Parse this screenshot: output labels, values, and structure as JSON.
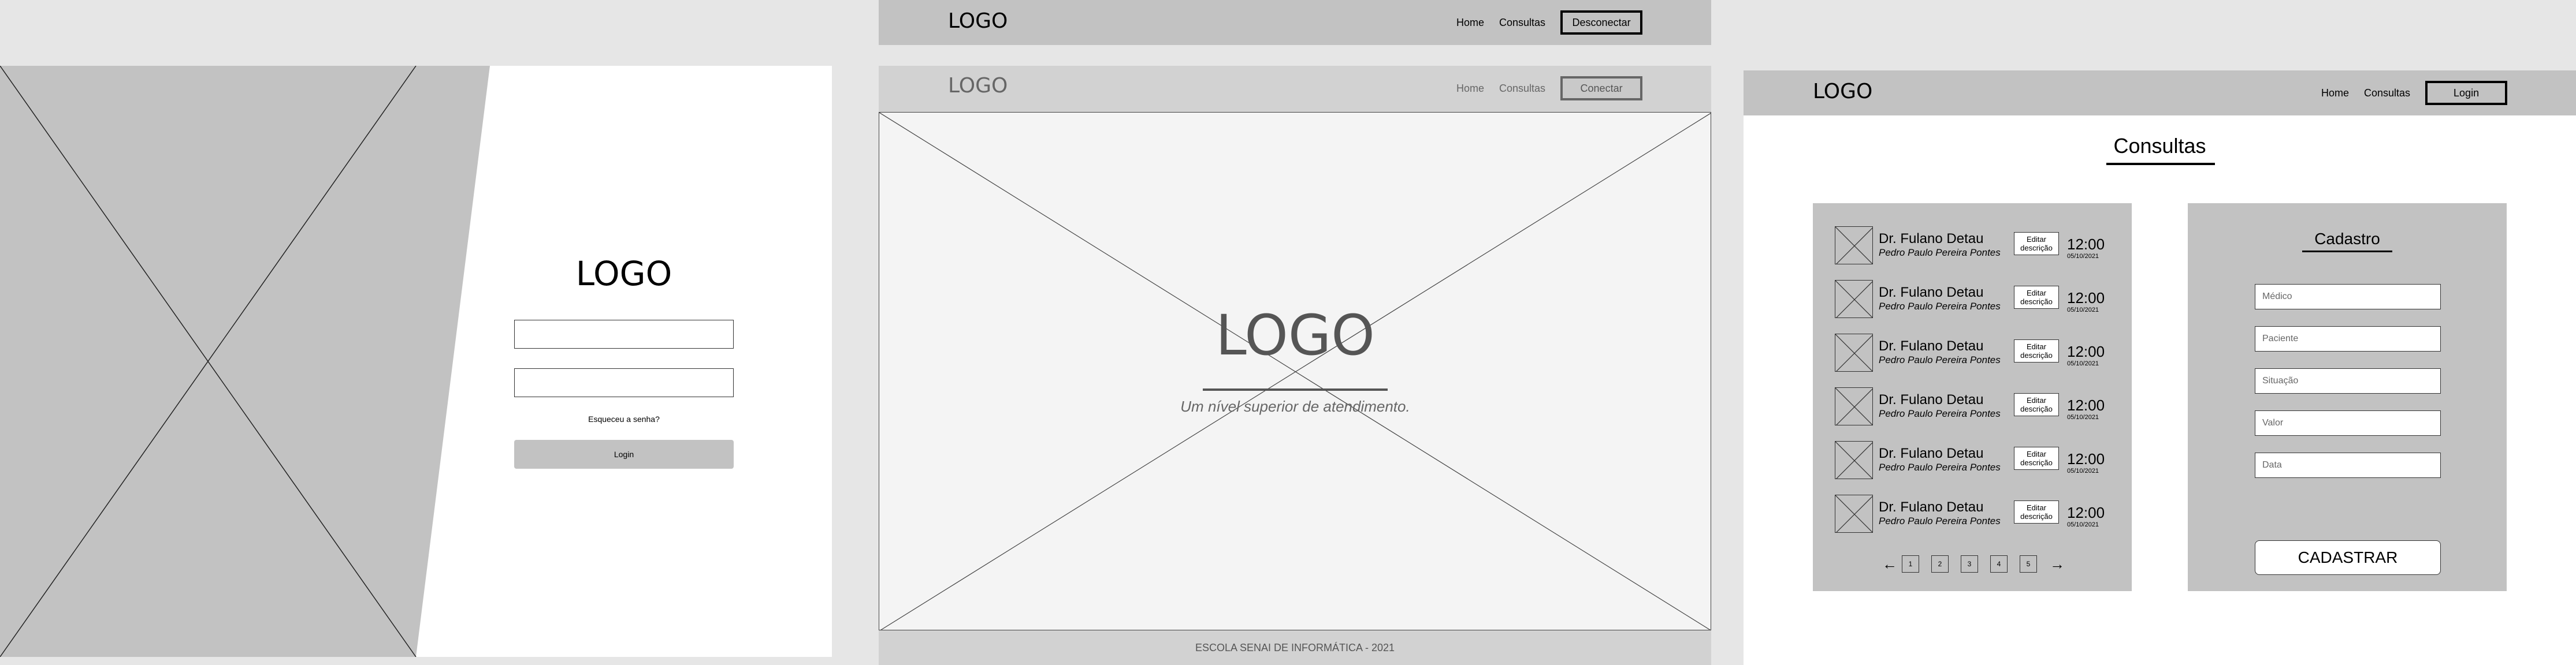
{
  "login": {
    "logo": "LOGO",
    "forgot_password": "Esqueceu a senha?",
    "login_button": "Login"
  },
  "home": {
    "top_nav": {
      "logo": "LOGO",
      "home": "Home",
      "consultas": "Consultas",
      "action": "Desconectar"
    },
    "main_nav": {
      "logo": "LOGO",
      "home": "Home",
      "consultas": "Consultas",
      "action": "Conectar"
    },
    "hero": {
      "logo": "LOGO",
      "tagline": "Um nível superior de atendimento."
    },
    "footer": "ESCOLA SENAI DE INFORMÁTICA - 2021"
  },
  "consultas": {
    "nav": {
      "logo": "LOGO",
      "home": "Home",
      "consultas": "Consultas",
      "action": "Login"
    },
    "title": "Consultas",
    "appointments": [
      {
        "doctor": "Dr. Fulano Detau",
        "patient": "Pedro Paulo Pereira Pontes",
        "edit": "Editar descrição",
        "time": "12:00",
        "date": "05/10/2021"
      },
      {
        "doctor": "Dr. Fulano Detau",
        "patient": "Pedro Paulo Pereira Pontes",
        "edit": "Editar descrição",
        "time": "12:00",
        "date": "05/10/2021"
      },
      {
        "doctor": "Dr. Fulano Detau",
        "patient": "Pedro Paulo Pereira Pontes",
        "edit": "Editar descrição",
        "time": "12:00",
        "date": "05/10/2021"
      },
      {
        "doctor": "Dr. Fulano Detau",
        "patient": "Pedro Paulo Pereira Pontes",
        "edit": "Editar descrição",
        "time": "12:00",
        "date": "05/10/2021"
      },
      {
        "doctor": "Dr. Fulano Detau",
        "patient": "Pedro Paulo Pereira Pontes",
        "edit": "Editar descrição",
        "time": "12:00",
        "date": "05/10/2021"
      },
      {
        "doctor": "Dr. Fulano Detau",
        "patient": "Pedro Paulo Pereira Pontes",
        "edit": "Editar descrição",
        "time": "12:00",
        "date": "05/10/2021"
      }
    ],
    "pagination": {
      "prev": "←",
      "next": "→",
      "pages": [
        "1",
        "2",
        "3",
        "4",
        "5"
      ]
    },
    "form": {
      "title": "Cadastro",
      "fields": [
        {
          "placeholder": "Médico"
        },
        {
          "placeholder": "Paciente"
        },
        {
          "placeholder": "Situação"
        },
        {
          "placeholder": "Valor"
        },
        {
          "placeholder": "Data"
        }
      ],
      "submit": "CADASTRAR"
    }
  },
  "colors": {
    "background": "#e6e6e6",
    "wire_gray": "#c2c2c2",
    "light_gray": "#d2d2d2",
    "hero_bg": "#f4f4f4"
  },
  "icons": {
    "image_placeholder": "x-cross-icon",
    "arrow_left": "arrow-left-icon",
    "arrow_right": "arrow-right-icon"
  }
}
